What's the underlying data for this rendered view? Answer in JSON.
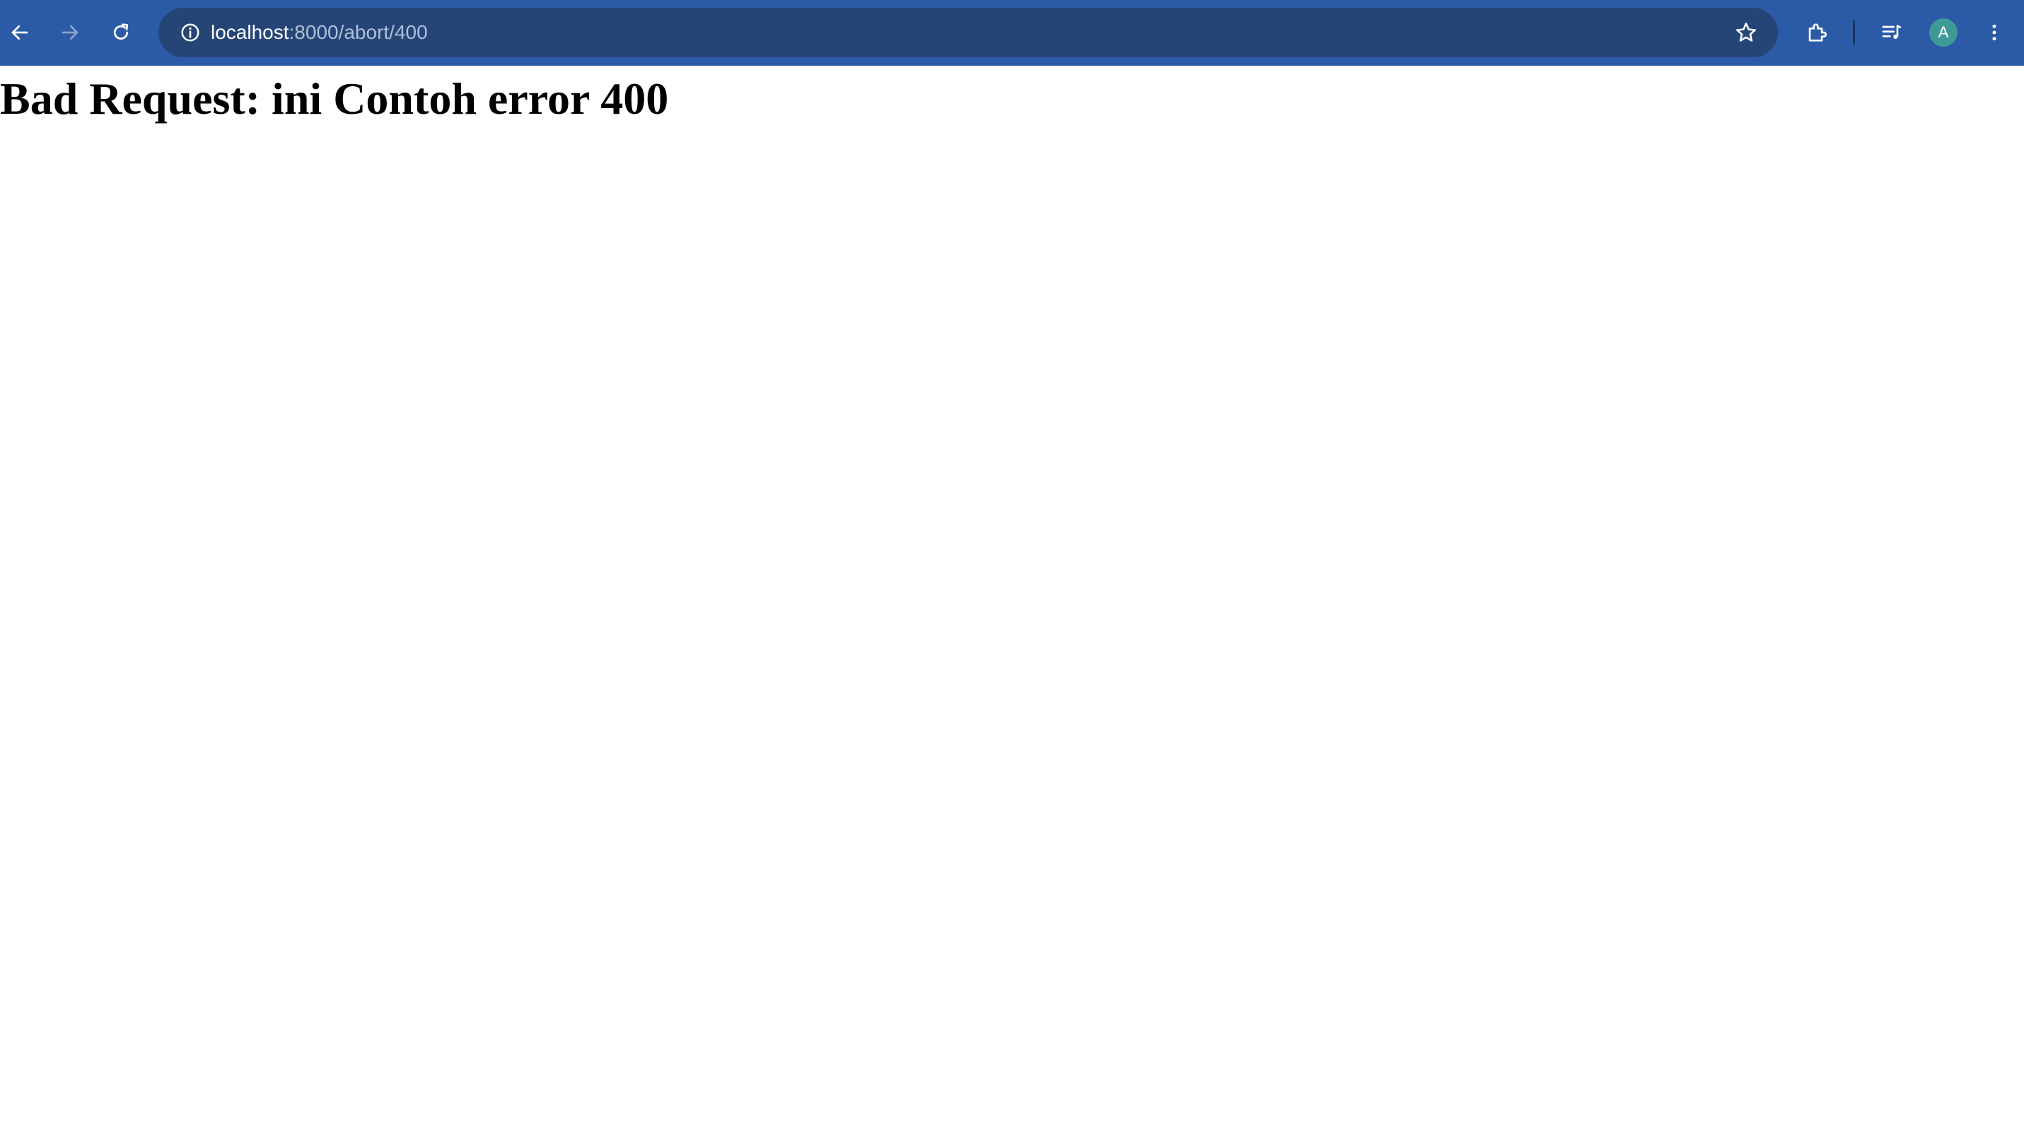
{
  "browser": {
    "omnibox": {
      "host": "localhost",
      "path": ":8000/abort/400"
    },
    "profile_initial": "A",
    "icons": {
      "back": "back-arrow-icon",
      "forward": "forward-arrow-icon",
      "reload": "reload-icon",
      "site_info": "info-icon",
      "bookmark": "star-icon",
      "extensions": "puzzle-icon",
      "media": "media-queue-icon",
      "menu": "kebab-menu-icon"
    },
    "colors": {
      "toolbar": "#2b5aa6",
      "omnibox": "#264577",
      "avatar": "#3d9a96"
    }
  },
  "page": {
    "heading": "Bad Request: ini Contoh error 400"
  }
}
